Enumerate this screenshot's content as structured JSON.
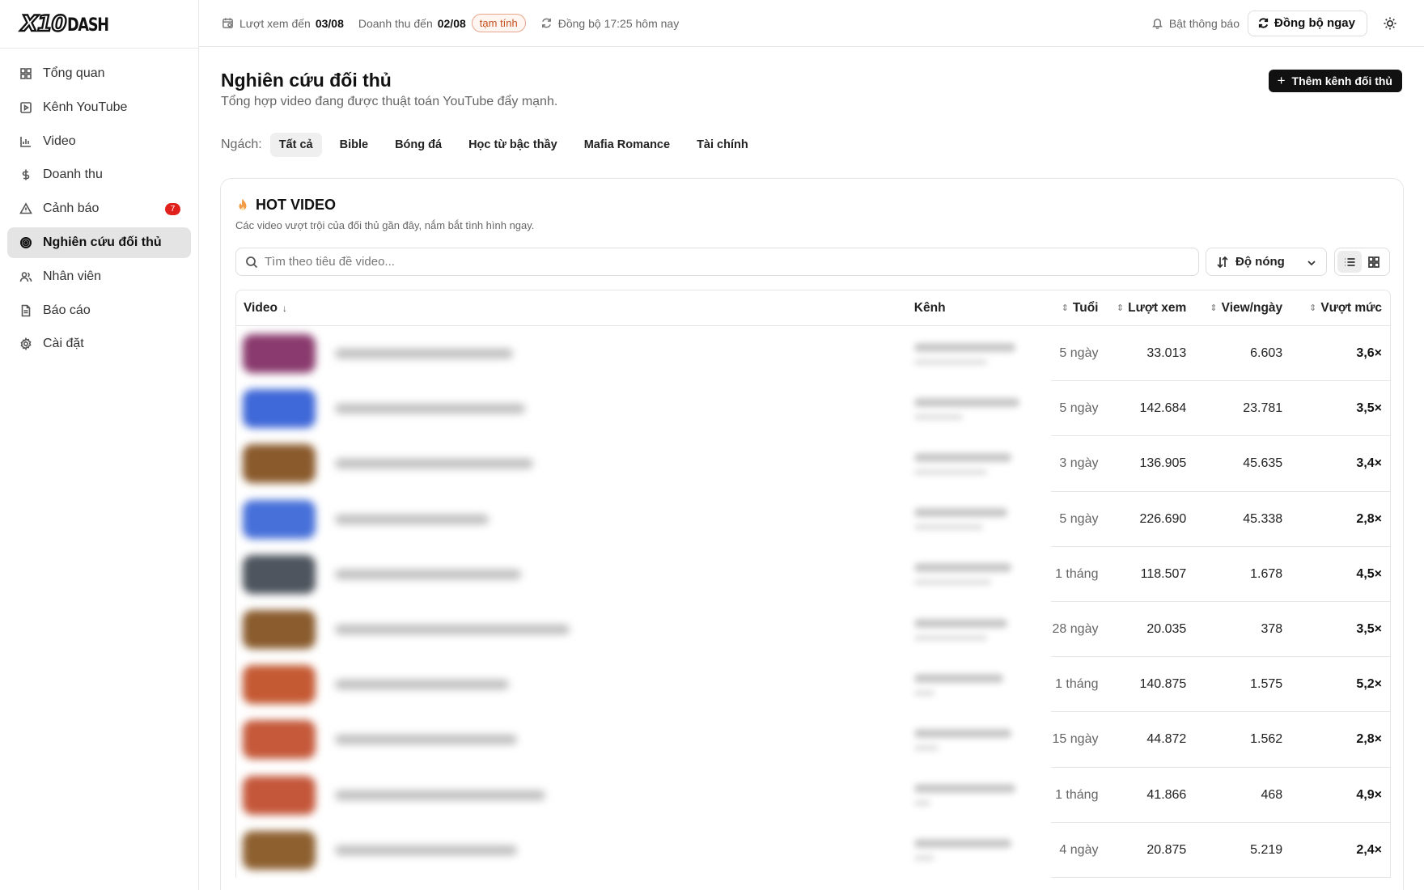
{
  "brand": {
    "logo_mark": "X10",
    "logo_text": "DASH"
  },
  "sidebar": {
    "items": [
      {
        "label": "Tổng quan",
        "icon": "grid-icon"
      },
      {
        "label": "Kênh YouTube",
        "icon": "play-icon"
      },
      {
        "label": "Video",
        "icon": "bar-chart-icon"
      },
      {
        "label": "Doanh thu",
        "icon": "dollar-icon"
      },
      {
        "label": "Cảnh báo",
        "icon": "warning-icon",
        "badge": "7"
      },
      {
        "label": "Nghiên cứu đối thủ",
        "icon": "target-icon",
        "active": true
      },
      {
        "label": "Nhân viên",
        "icon": "users-icon"
      },
      {
        "label": "Báo cáo",
        "icon": "file-icon"
      },
      {
        "label": "Cài đặt",
        "icon": "gear-icon"
      }
    ]
  },
  "topbar": {
    "views_label": "Lượt xem đến",
    "views_date": "03/08",
    "revenue_label": "Doanh thu đến",
    "revenue_date": "02/08",
    "revenue_badge": "tạm tính",
    "sync_status": "Đồng bộ 17:25 hôm nay",
    "notify_label": "Bật thông báo",
    "sync_button": "Đồng bộ ngay"
  },
  "page": {
    "title": "Nghiên cứu đối thủ",
    "subtitle": "Tổng hợp video đang được thuật toán YouTube đẩy mạnh.",
    "add_button": "Thêm kênh đối thủ",
    "niche_label": "Ngách:",
    "niches": [
      "Tất cả",
      "Bible",
      "Bóng đá",
      "Học từ bậc thầy",
      "Mafia Romance",
      "Tài chính"
    ],
    "active_niche": "Tất cả"
  },
  "card": {
    "title": "HOT VIDEO",
    "subtitle": "Các video vượt trội của đối thủ gần đây, nắm bắt tình hình ngay.",
    "search_placeholder": "Tìm theo tiêu đề video...",
    "sort_value": "Độ nóng"
  },
  "table": {
    "columns": [
      "Video",
      "Kênh",
      "Tuổi",
      "Lượt xem",
      "View/ngày",
      "Vượt mức"
    ],
    "rows": [
      {
        "age": "5 ngày",
        "views": "33.013",
        "per_day": "6.603",
        "ratio": "3,6×",
        "thumb": "#8a3a6e"
      },
      {
        "age": "5 ngày",
        "views": "142.684",
        "per_day": "23.781",
        "ratio": "3,5×",
        "thumb": "#3f68d8"
      },
      {
        "age": "3 ngày",
        "views": "136.905",
        "per_day": "45.635",
        "ratio": "3,4×",
        "thumb": "#8a5a2c"
      },
      {
        "age": "5 ngày",
        "views": "226.690",
        "per_day": "45.338",
        "ratio": "2,8×",
        "thumb": "#4770d9"
      },
      {
        "age": "1 tháng",
        "views": "118.507",
        "per_day": "1.678",
        "ratio": "4,5×",
        "thumb": "#4e555e"
      },
      {
        "age": "28 ngày",
        "views": "20.035",
        "per_day": "378",
        "ratio": "3,5×",
        "thumb": "#8a5c2e"
      },
      {
        "age": "1 tháng",
        "views": "140.875",
        "per_day": "1.575",
        "ratio": "5,2×",
        "thumb": "#c45a34"
      },
      {
        "age": "15 ngày",
        "views": "44.872",
        "per_day": "1.562",
        "ratio": "2,8×",
        "thumb": "#c5593a"
      },
      {
        "age": "1 tháng",
        "views": "41.866",
        "per_day": "468",
        "ratio": "4,9×",
        "thumb": "#c4573a"
      },
      {
        "age": "4 ngày",
        "views": "20.875",
        "per_day": "5.219",
        "ratio": "2,4×",
        "thumb": "#8e6030"
      }
    ]
  }
}
